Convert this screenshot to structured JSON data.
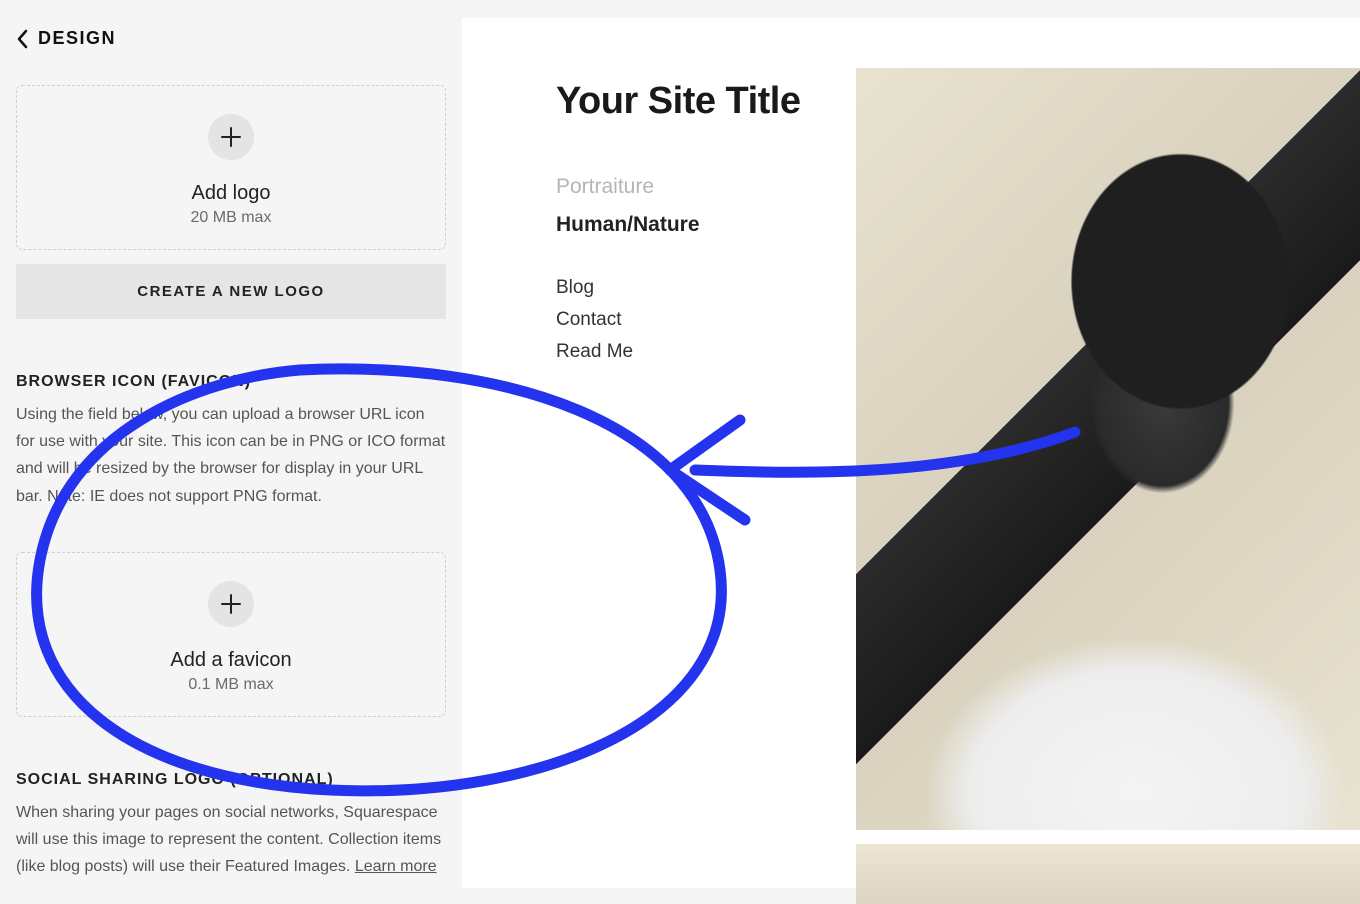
{
  "sidebar": {
    "back_label": "DESIGN",
    "logo_upload": {
      "title": "Add logo",
      "sub": "20 MB max"
    },
    "create_logo_label": "CREATE A NEW LOGO",
    "favicon_section": {
      "heading": "BROWSER ICON (FAVICON)",
      "desc": "Using the field below, you can upload a browser URL icon for use with your site. This icon can be in PNG or ICO format and will be resized by the browser for display in your URL bar. Note: IE does not support PNG format."
    },
    "favicon_upload": {
      "title": "Add a favicon",
      "sub": "0.1 MB max"
    },
    "social_section": {
      "heading": "SOCIAL SHARING LOGO (OPTIONAL)",
      "desc": "When sharing your pages on social networks, Squarespace will use this image to represent the content. Collection items (like blog posts) will use their Featured Images. ",
      "learn_more": "Learn more"
    }
  },
  "preview": {
    "site_title": "Your Site Title",
    "nav_primary": [
      {
        "label": "Portraiture",
        "muted": true
      },
      {
        "label": "Human/Nature",
        "bold": true
      }
    ],
    "nav_secondary": [
      {
        "label": "Blog"
      },
      {
        "label": "Contact"
      },
      {
        "label": "Read Me"
      }
    ]
  },
  "annotation": {
    "color": "#2333ee"
  }
}
